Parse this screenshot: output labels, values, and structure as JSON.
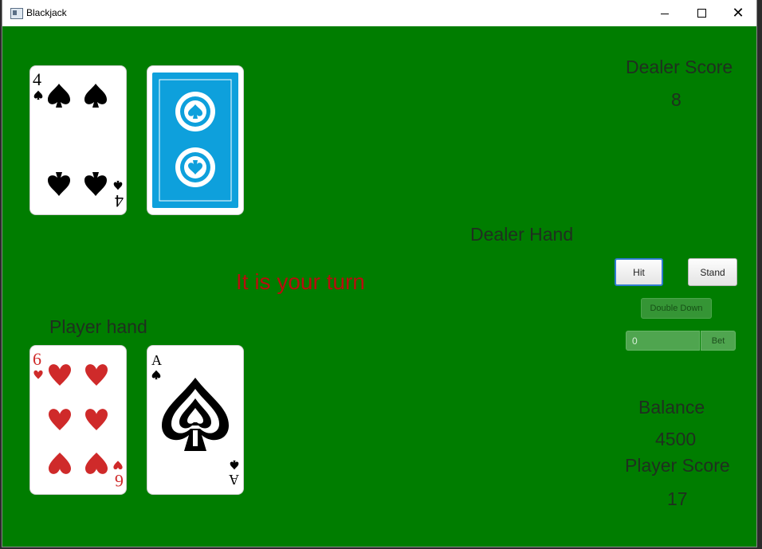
{
  "window": {
    "title": "Blackjack",
    "minimize_glyph": "",
    "close_glyph": "✕"
  },
  "dealer": {
    "score_label": "Dealer Score",
    "score_value": "8",
    "hand_label": "Dealer Hand",
    "cards": [
      {
        "rank": "4",
        "suit": "spades",
        "face_up": true
      },
      {
        "face_up": false,
        "back_color": "#0ea0dc"
      }
    ]
  },
  "player": {
    "hand_label": "Player hand",
    "score_label": "Player Score",
    "score_value": "17",
    "balance_label": "Balance",
    "balance_value": "4500",
    "cards": [
      {
        "rank": "6",
        "suit": "hearts",
        "face_up": true
      },
      {
        "rank": "A",
        "suit": "spades",
        "face_up": true
      }
    ]
  },
  "status": {
    "message": "It is your turn",
    "color": "#b80d0d"
  },
  "controls": {
    "hit_label": "Hit",
    "stand_label": "Stand",
    "double_down_label": "Double Down",
    "bet_value": "0",
    "bet_label": "Bet"
  },
  "colors": {
    "table": "#007d00",
    "label_text": "#1f2f1f",
    "heart_red": "#cf2a2a",
    "spade_black": "#000000"
  }
}
